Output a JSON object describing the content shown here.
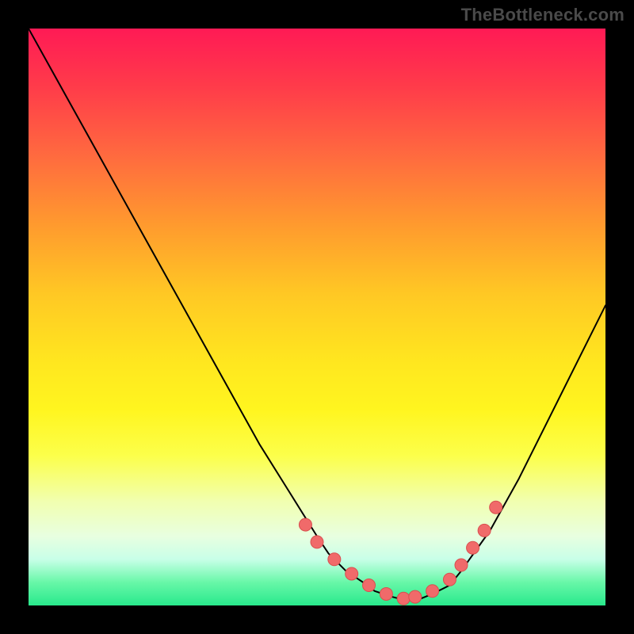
{
  "watermark": "TheBottleneck.com",
  "colors": {
    "curve": "#000000",
    "marker_fill": "#f06a6a",
    "marker_stroke": "#d94f4f"
  },
  "chart_data": {
    "type": "line",
    "title": "",
    "xlabel": "",
    "ylabel": "",
    "xlim": [
      0,
      100
    ],
    "ylim": [
      0,
      100
    ],
    "grid": false,
    "legend": false,
    "series": [
      {
        "name": "bottleneck-curve",
        "x": [
          0,
          5,
          10,
          15,
          20,
          25,
          30,
          35,
          40,
          45,
          50,
          52,
          55,
          58,
          60,
          63,
          65,
          68,
          70,
          73,
          75,
          80,
          85,
          90,
          95,
          100
        ],
        "values": [
          100,
          91,
          82,
          73,
          64,
          55,
          46,
          37,
          28,
          20,
          12,
          9,
          6,
          4,
          2.5,
          1.5,
          1,
          1.2,
          2,
          3.5,
          6,
          13,
          22,
          32,
          42,
          52
        ]
      }
    ],
    "markers": {
      "name": "highlight-points",
      "x": [
        48,
        50,
        53,
        56,
        59,
        62,
        65,
        67,
        70,
        73,
        75,
        77,
        79,
        81
      ],
      "values": [
        14,
        11,
        8,
        5.5,
        3.5,
        2,
        1.2,
        1.5,
        2.5,
        4.5,
        7,
        10,
        13,
        17
      ]
    }
  }
}
